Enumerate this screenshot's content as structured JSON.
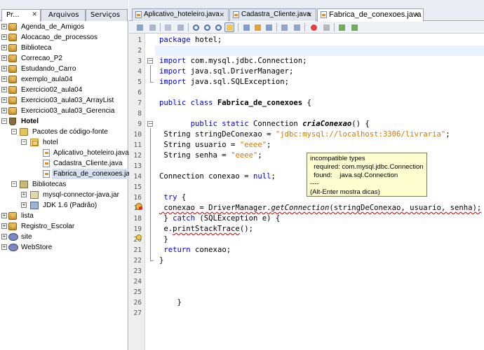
{
  "left_tabs": [
    {
      "label": "Pr..."
    },
    {
      "label": "Arquivos"
    },
    {
      "label": "Serviços"
    }
  ],
  "tree": [
    {
      "label": "Agenda_de_Amigos",
      "icon": "project-icon"
    },
    {
      "label": "Alocacao_de_processos",
      "icon": "project-icon"
    },
    {
      "label": "Biblioteca",
      "icon": "project-icon"
    },
    {
      "label": "Correcao_P2",
      "icon": "project-icon"
    },
    {
      "label": "Estudando_Carro",
      "icon": "project-icon"
    },
    {
      "label": "exemplo_aula04",
      "icon": "project-icon"
    },
    {
      "label": "Exercicio02_aula04",
      "icon": "project-icon"
    },
    {
      "label": "Exercicio03_aula03_ArrayList",
      "icon": "project-icon"
    },
    {
      "label": "Exercicio03_aula03_Gerencia",
      "icon": "project-icon"
    },
    {
      "label": "Hotel",
      "icon": "java-project-icon"
    },
    {
      "label": "Pacotes de código-fonte",
      "icon": "source-folder-icon"
    },
    {
      "label": "hotel",
      "icon": "package-icon"
    },
    {
      "label": "Aplicativo_hoteleiro.java",
      "icon": "java-file-icon"
    },
    {
      "label": "Cadastra_Cliente.java",
      "icon": "java-file-icon"
    },
    {
      "label": "Fabrica_de_conexoes.java",
      "icon": "java-file-icon"
    },
    {
      "label": "Bibliotecas",
      "icon": "libraries-icon"
    },
    {
      "label": "mysql-connector-java.jar",
      "icon": "jar-icon"
    },
    {
      "label": "JDK 1.6 (Padrão)",
      "icon": "jdk-icon"
    },
    {
      "label": "lista",
      "icon": "project-icon"
    },
    {
      "label": "Registro_Escolar",
      "icon": "project-icon"
    },
    {
      "label": "site",
      "icon": "php-project-icon"
    },
    {
      "label": "WebStore",
      "icon": "php-project-icon"
    }
  ],
  "editor_tabs": [
    {
      "label": "Aplicativo_hoteleiro.java"
    },
    {
      "label": "Cadastra_Cliente.java"
    },
    {
      "label": "Fabrica_de_conexoes.java"
    }
  ],
  "editor": {
    "line_numbers": [
      "1",
      "2",
      "3",
      "4",
      "5",
      "6",
      "7",
      "8",
      "9",
      "10",
      "11",
      "12",
      "13",
      "14",
      "15",
      "16",
      "17",
      "18",
      "19",
      "20",
      "21",
      "22",
      "23",
      "24",
      "25",
      "26",
      "27"
    ]
  },
  "code": {
    "l1_kw": "package",
    "l1_rest": " hotel;",
    "l3_kw": "import",
    "l3_rest": " com.mysql.jdbc.Connection;",
    "l4_kw": "import",
    "l4_rest": " java.sql.DriverManager;",
    "l5_kw": "import",
    "l5_rest": " java.sql.SQLException;",
    "l7_kw1": "public class",
    "l7_name": " Fabrica_de_conexoes",
    "l7_rest": " {",
    "l9_indent": "       ",
    "l9_kw": "public static",
    "l9_type": " Connection ",
    "l9_method": "criaConexao",
    "l9_rest": "() {",
    "l10_a": " String stringDeConexao = ",
    "l10_str": "\"jdbc:mysql://localhost:3306/livraria\"",
    "l10_b": ";",
    "l11_a": " String usuario = ",
    "l11_str": "\"eeee\"",
    "l11_b": ";",
    "l12_a": " String senha = ",
    "l12_str": "\"eeee\"",
    "l12_b": ";",
    "l14_a": "Connection conexao = ",
    "l14_kw": "null",
    "l14_b": ";",
    "l16_a": " ",
    "l16_kw": "try",
    "l16_b": " {",
    "l17_a": " conexao = DriverManager.",
    "l17_m": "getConnection",
    "l17_b": "(stringDeConexao, usuario, senha);",
    "l18_a": " } ",
    "l18_kw": "catch",
    "l18_b": " (SQLException e) {",
    "l19_a": " e.",
    "l19_m": "printStackTrace",
    "l19_b": "();",
    "l20": " }",
    "l21_a": " ",
    "l21_kw": "return",
    "l21_b": " conexao;",
    "l22": "}",
    "l26": "    }"
  },
  "tooltip": {
    "line1": "incompatible types",
    "line2": "  required: com.mysql.jdbc.Connection",
    "line3": "  found:    java.sql.Connection",
    "line4": "----",
    "line5": "(Alt-Enter mostra dicas)"
  },
  "colors": {
    "keyword": "#0000e6",
    "string": "#ce7b00",
    "error_underline": "#e01010",
    "tooltip_bg": "#fdfdd0",
    "current_line": "#e8f2fe"
  }
}
